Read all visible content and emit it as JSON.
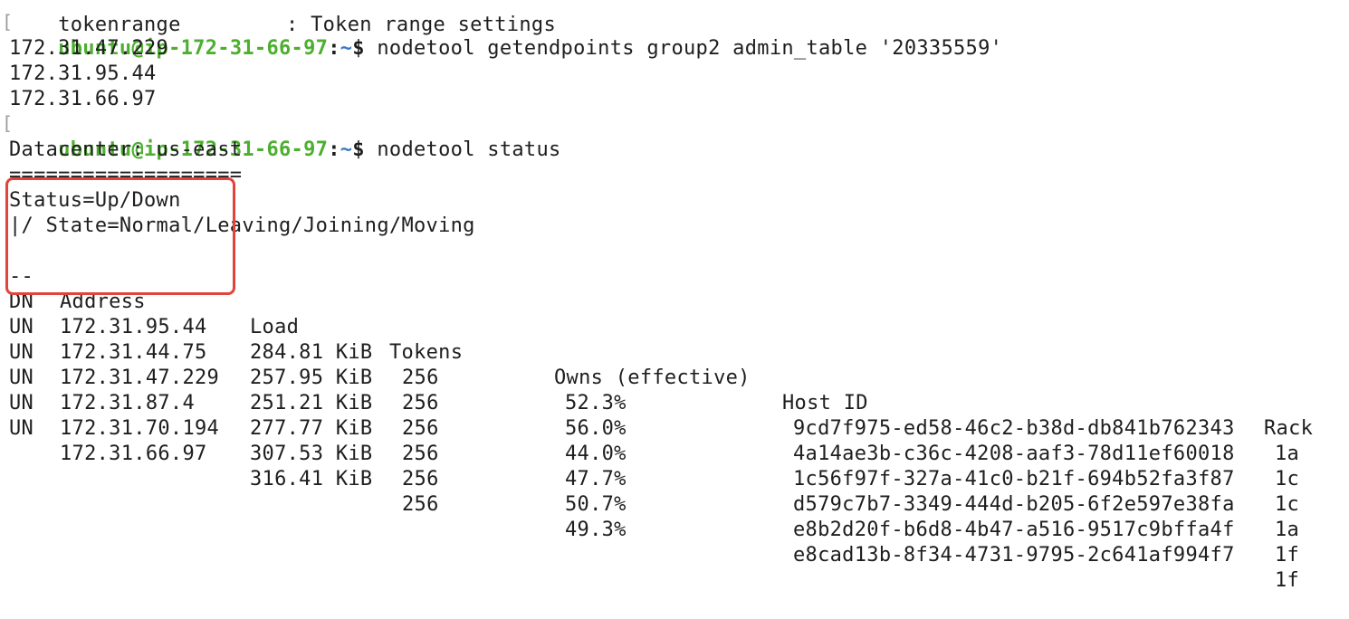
{
  "partial_top_line": {
    "left": "tokenrange",
    "right": ": Token range settings"
  },
  "commands": [
    {
      "user": "ubuntu@ip-172-31-66-97",
      "path": "~",
      "symbol": "$",
      "text": "nodetool getendpoints group2 admin_table '20335559'"
    },
    {
      "user": "ubuntu@ip-172-31-66-97",
      "path": "~",
      "symbol": "$",
      "text": "nodetool status"
    }
  ],
  "endpoints": [
    "172.31.47.229",
    "172.31.95.44",
    "172.31.66.97"
  ],
  "status": {
    "datacenter": "Datacenter: us-east",
    "divider": "===================",
    "legend1": "Status=Up/Down",
    "legend2": "|/ State=Normal/Leaving/Joining/Moving",
    "headers": {
      "state": "--",
      "address": "Address",
      "load": "Load",
      "tokens": "Tokens",
      "owns": "Owns (effective)",
      "host": "Host ID",
      "rack": "Rack"
    },
    "rows": [
      {
        "state": "DN",
        "address": "172.31.95.44",
        "load": "284.81 KiB",
        "tokens": "256",
        "owns": "52.3%",
        "host": "9cd7f975-ed58-46c2-b38d-db841b762343",
        "rack": "1a"
      },
      {
        "state": "UN",
        "address": "172.31.44.75",
        "load": "257.95 KiB",
        "tokens": "256",
        "owns": "56.0%",
        "host": "4a14ae3b-c36c-4208-aaf3-78d11ef60018",
        "rack": "1c"
      },
      {
        "state": "UN",
        "address": "172.31.47.229",
        "load": "251.21 KiB",
        "tokens": "256",
        "owns": "44.0%",
        "host": "1c56f97f-327a-41c0-b21f-694b52fa3f87",
        "rack": "1c"
      },
      {
        "state": "UN",
        "address": "172.31.87.4",
        "load": "277.77 KiB",
        "tokens": "256",
        "owns": "47.7%",
        "host": "d579c7b7-3349-444d-b205-6f2e597e38fa",
        "rack": "1a"
      },
      {
        "state": "UN",
        "address": "172.31.70.194",
        "load": "307.53 KiB",
        "tokens": "256",
        "owns": "50.7%",
        "host": "e8b2d20f-b6d8-4b47-a516-9517c9bffa4f",
        "rack": "1f"
      },
      {
        "state": "UN",
        "address": "172.31.66.97",
        "load": "316.41 KiB",
        "tokens": "256",
        "owns": "49.3%",
        "host": "e8cad13b-8f34-4731-9795-2c641af994f7",
        "rack": "1f"
      }
    ]
  },
  "colors": {
    "prompt_user": "#4caf2f",
    "prompt_path": "#3b78c4",
    "highlight": "#e0443b"
  }
}
